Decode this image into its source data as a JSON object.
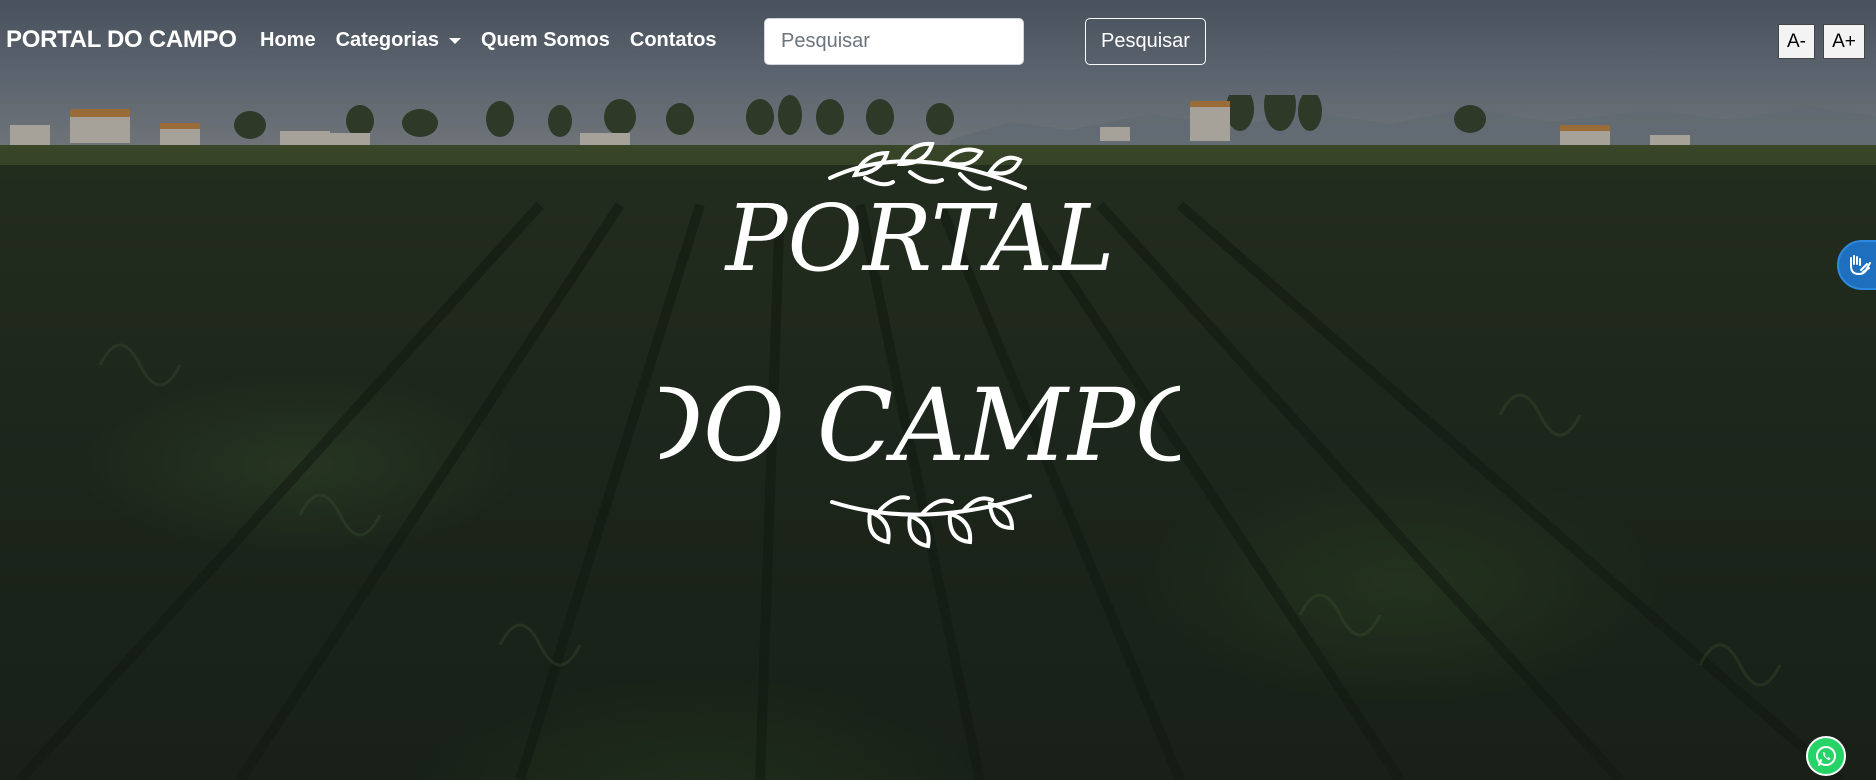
{
  "navbar": {
    "brand": "PORTAL DO CAMPO",
    "links": [
      {
        "label": "Home"
      },
      {
        "label": "Categorias",
        "dropdown": true
      },
      {
        "label": "Quem Somos"
      },
      {
        "label": "Contatos"
      }
    ],
    "search": {
      "placeholder": "Pesquisar",
      "value": "",
      "button_label": "Pesquisar"
    },
    "font_controls": {
      "decrease_label": "A-",
      "increase_label": "A+"
    }
  },
  "hero": {
    "logo_line1": "PORTAL",
    "logo_line2": "DO CAMPO",
    "ornament_icon": "wheat-branch-icon"
  },
  "widgets": {
    "accessibility_icon": "sign-language-hands-icon",
    "whatsapp_icon": "whatsapp-icon"
  },
  "colors": {
    "nav_text": "#ffffff",
    "accessibility_blue": "#1f6fbf",
    "whatsapp_green": "#25d366"
  }
}
